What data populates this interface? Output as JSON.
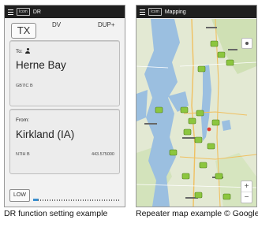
{
  "dr_screen": {
    "title": "DR",
    "tx_button": "TX",
    "mode": "DV",
    "duplex": "DUP+",
    "to": {
      "label": "To:",
      "name": "Herne Bay",
      "callsign": "GB7IC B"
    },
    "from": {
      "label": "From:",
      "name": "Kirkland (IA)",
      "callsign": "N7IH  B",
      "frequency": "443.575000"
    },
    "power_button": "LOW",
    "meter_level": 0.06
  },
  "map_screen": {
    "title": "Mapping",
    "zoom_in": "+",
    "zoom_out": "−"
  },
  "captions": {
    "left": "DR function setting example",
    "right": "Repeater map example © Google"
  },
  "colors": {
    "titlebar": "#1f1f1f",
    "meter": "#3a8fd0",
    "water": "#8fb6d8",
    "land": "#dfe6cf",
    "pin": "#8cc63f"
  }
}
